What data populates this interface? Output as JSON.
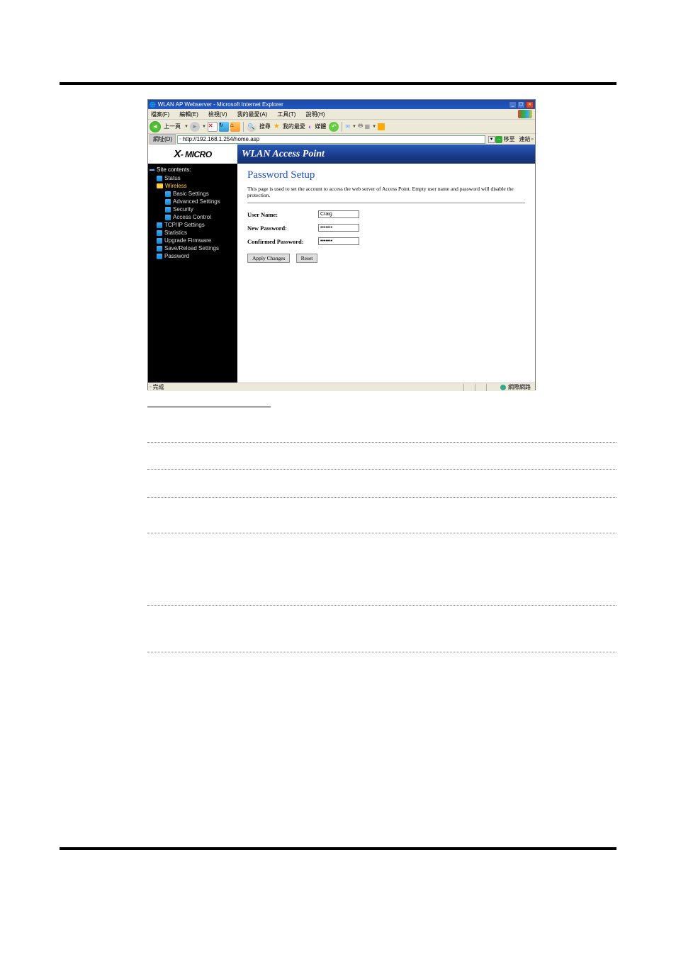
{
  "window": {
    "title": "WLAN AP Webserver - Microsoft Internet Explorer"
  },
  "menus": {
    "file": "檔案(F)",
    "edit": "編輯(E)",
    "view": "檢視(V)",
    "favorites": "我的最愛(A)",
    "tools": "工具(T)",
    "help": "說明(H)"
  },
  "toolbar": {
    "back": "上一頁",
    "search": "搜尋",
    "favorites": "我的最愛",
    "media": "媒體"
  },
  "addressbar": {
    "label": "網址(D)",
    "url": "http://192.168.1.254/home.asp",
    "go": "移至",
    "links": "連結"
  },
  "brand": "X- MICRO",
  "banner": "WLAN Access Point",
  "sidebar": {
    "root": "Site contents:",
    "items": [
      {
        "label": "Status"
      },
      {
        "label": "Wireless",
        "open": true
      },
      {
        "label": "Basic Settings",
        "sub": true
      },
      {
        "label": "Advanced Settings",
        "sub": true
      },
      {
        "label": "Security",
        "sub": true
      },
      {
        "label": "Access Control",
        "sub": true
      },
      {
        "label": "TCP/IP Settings"
      },
      {
        "label": "Statistics"
      },
      {
        "label": "Upgrade Firmware"
      },
      {
        "label": "Save/Reload Settings"
      },
      {
        "label": "Password"
      }
    ]
  },
  "page": {
    "heading": "Password Setup",
    "desc": "This page is used to set the account to access the web server of Access Point. Empty user name and password will disable the protection.",
    "fields": {
      "username_label": "User Name:",
      "username_value": "Craig",
      "newpass_label": "New Password:",
      "newpass_value": "•••••••",
      "confpass_label": "Confirmed Password:",
      "confpass_value": "•••••••"
    },
    "buttons": {
      "apply": "Apply Changes",
      "reset": "Reset"
    }
  },
  "status": {
    "done": "完成",
    "zone": "網際網路"
  }
}
